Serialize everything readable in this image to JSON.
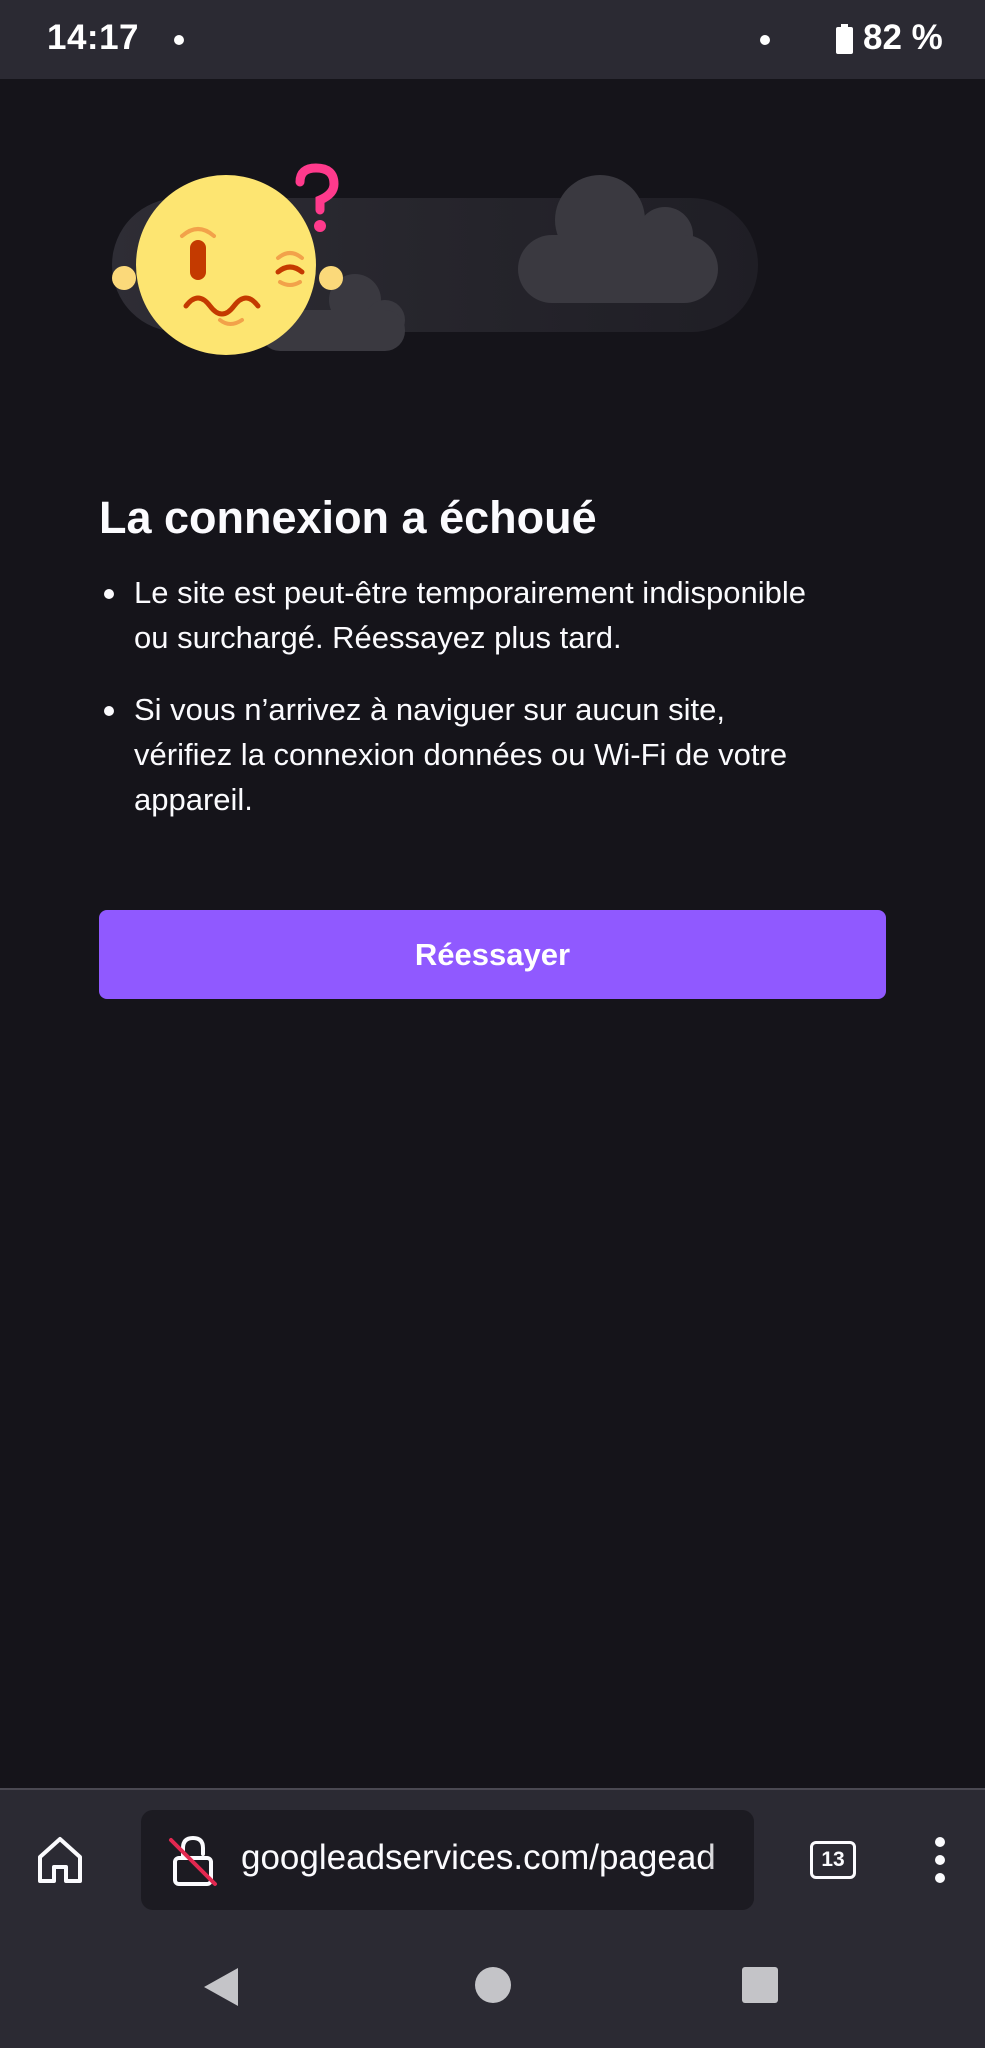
{
  "status_bar": {
    "time": "14:17",
    "battery": "82 %"
  },
  "error_page": {
    "title": "La connexion a échoué",
    "bullets": [
      "Le site est peut-être temporairement indisponible ou surchargé. Réessayez plus tard.",
      "Si vous n’arrivez à naviguer sur aucun site, vérifiez la connexion données ou Wi-Fi de votre appareil."
    ],
    "retry_label": "Réessayer"
  },
  "toolbar": {
    "url": "googleadservices.com/pagead",
    "tab_count": "13",
    "home_icon": "home-icon",
    "lock_icon": "broken-lock-icon",
    "menu_icon": "more-vertical-icon"
  },
  "colors": {
    "background": "#15141a",
    "bar": "#2b2a33",
    "accent": "#9059ff",
    "url_bar": "#1c1b22"
  }
}
